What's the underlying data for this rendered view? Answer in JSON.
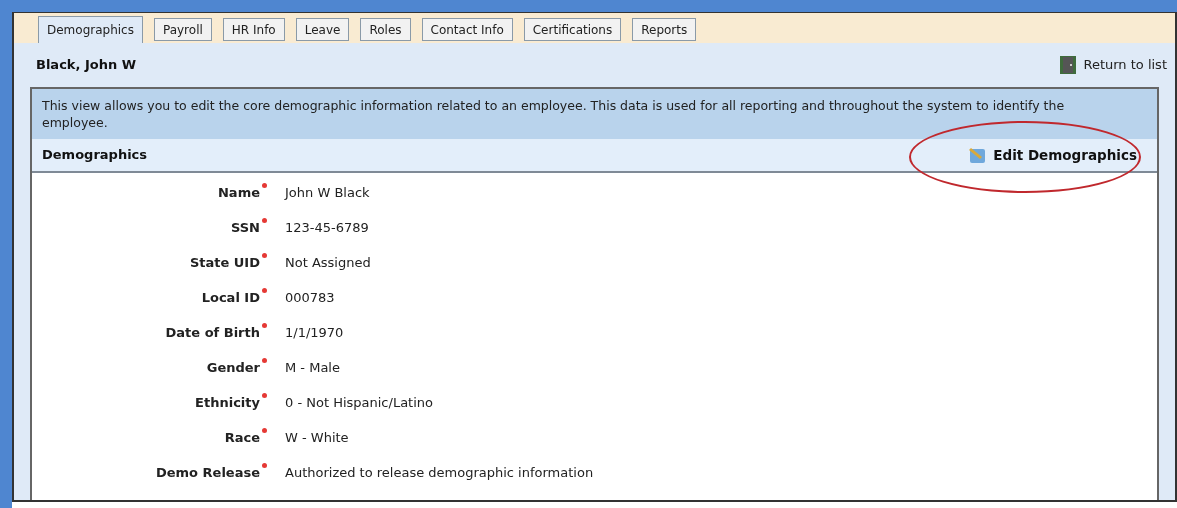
{
  "tabs": [
    {
      "label": "Demographics",
      "selected": true
    },
    {
      "label": "Payroll",
      "selected": false
    },
    {
      "label": "HR Info",
      "selected": false
    },
    {
      "label": "Leave",
      "selected": false
    },
    {
      "label": "Roles",
      "selected": false
    },
    {
      "label": "Contact Info",
      "selected": false
    },
    {
      "label": "Certifications",
      "selected": false
    },
    {
      "label": "Reports",
      "selected": false
    }
  ],
  "employee_name": "Black, John W",
  "return_link": "Return to list",
  "info_text": "This view allows you to edit the core demographic information related to an employee. This data is used for all reporting and throughout the system to identify the employee.",
  "section": {
    "title": "Demographics",
    "edit_button": "Edit Demographics",
    "highlighted": true
  },
  "fields": [
    {
      "label": "Name",
      "required": true,
      "value": "John W Black"
    },
    {
      "label": "SSN",
      "required": true,
      "value": "123-45-6789"
    },
    {
      "label": "State UID",
      "required": true,
      "value": "Not Assigned"
    },
    {
      "label": "Local ID",
      "required": true,
      "value": "000783"
    },
    {
      "label": "Date of Birth",
      "required": true,
      "value": "1/1/1970"
    },
    {
      "label": "Gender",
      "required": true,
      "value": "M - Male"
    },
    {
      "label": "Ethnicity",
      "required": true,
      "value": "0 - Not Hispanic/Latino"
    },
    {
      "label": "Race",
      "required": true,
      "value": "W - White"
    },
    {
      "label": "Demo Release",
      "required": true,
      "value": "Authorized to release demographic information"
    }
  ]
}
